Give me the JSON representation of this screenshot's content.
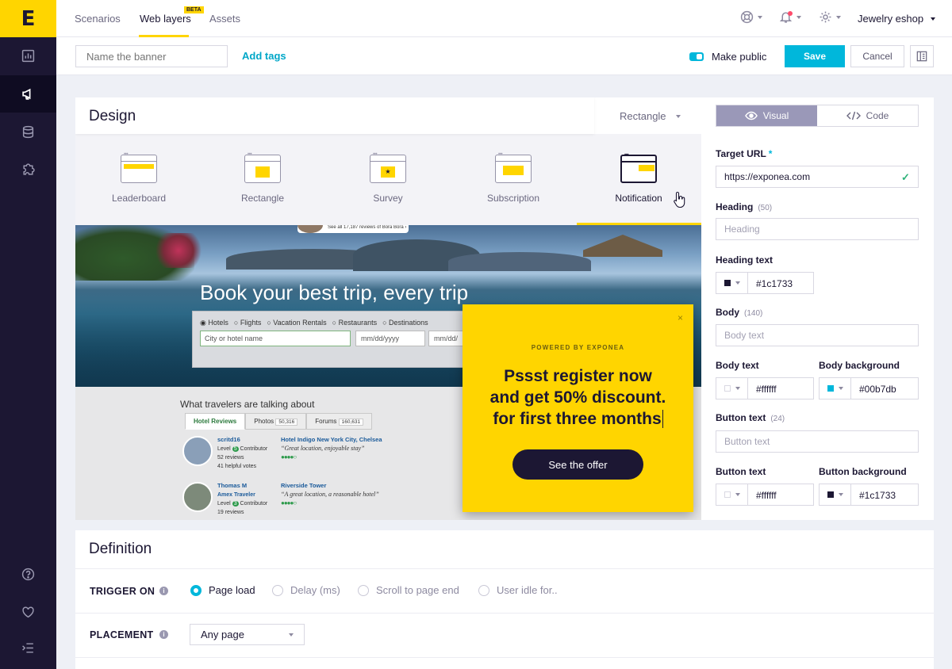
{
  "brand": {
    "logo_text": "E"
  },
  "sidebar": {
    "items": [
      {
        "icon": "chart-icon"
      },
      {
        "icon": "megaphone-icon",
        "active": true
      },
      {
        "icon": "database-icon"
      },
      {
        "icon": "puzzle-icon"
      }
    ],
    "bottom_items": [
      {
        "icon": "help-icon"
      },
      {
        "icon": "heart-icon"
      },
      {
        "icon": "collapse-menu-icon"
      }
    ]
  },
  "topnav": {
    "tabs": [
      {
        "label": "Scenarios"
      },
      {
        "label": "Web layers",
        "badge": "BETA",
        "active": true
      },
      {
        "label": "Assets"
      }
    ],
    "account_label": "Jewelry eshop"
  },
  "toolbar": {
    "name_placeholder": "Name the banner",
    "add_tags_label": "Add tags",
    "make_public_label": "Make public",
    "make_public_on": true,
    "save_label": "Save",
    "cancel_label": "Cancel"
  },
  "design": {
    "title": "Design",
    "shape_selected": "Rectangle",
    "templates": [
      {
        "label": "Leaderboard"
      },
      {
        "label": "Rectangle"
      },
      {
        "label": "Survey"
      },
      {
        "label": "Subscription"
      },
      {
        "label": "Notification",
        "active": true
      }
    ]
  },
  "preview": {
    "reviews_count_text": "See all 17,187 reviews of Bora Bora ›",
    "headline": "Book your best trip, every trip",
    "search_options": [
      "Hotels",
      "Flights",
      "Vacation Rentals",
      "Restaurants",
      "Destinations"
    ],
    "city_placeholder": "City or hotel name",
    "date_placeholder_1": "mm/dd/yyyy",
    "date_placeholder_2": "mm/dd/",
    "talk_title": "What travelers are talking about",
    "tabs": [
      {
        "label": "Hotel Reviews"
      },
      {
        "label": "Photos",
        "count": "50,316"
      },
      {
        "label": "Forums",
        "count": "160,631"
      }
    ],
    "reviews": [
      {
        "name": "scritd16",
        "level": "Level",
        "level_num": "5",
        "role": "Contributor",
        "reviews": "52 reviews",
        "votes": "41 helpful votes",
        "hotel": "Hotel Indigo New York City, Chelsea",
        "quote": "“Great location, enjoyable stay”"
      },
      {
        "name": "Thomas M",
        "name2": "Amex Traveler",
        "level": "Level",
        "level_num": "3",
        "role": "Contributor",
        "reviews": "19 reviews",
        "hotel": "Riverside Tower",
        "quote": "“A great location, a reasonable hotel”"
      }
    ]
  },
  "popup": {
    "close_glyph": "×",
    "powered_by": "POWERED BY EXPONEA",
    "heading_line1": "Pssst register now",
    "heading_line2": "and get 50% discount.",
    "heading_line3": "for first three months",
    "button_label": "See the offer",
    "background": "#ffd500"
  },
  "panel": {
    "tabs": [
      {
        "label": "Visual",
        "active": true
      },
      {
        "label": "Code"
      }
    ],
    "target_url_label": "Target URL",
    "target_url_required": "*",
    "target_url_value": "https://exponea.com",
    "heading_label": "Heading",
    "heading_count": "(50)",
    "heading_placeholder": "Heading",
    "heading_text_label": "Heading text",
    "heading_text_color": "#1c1733",
    "body_label": "Body",
    "body_count": "(140)",
    "body_placeholder": "Body text",
    "body_text_label": "Body text",
    "body_text_color": "#ffffff",
    "body_background_label": "Body background",
    "body_background_color": "#00b7db",
    "button_text_label": "Button text",
    "button_text_count": "(24)",
    "button_text_placeholder": "Button text",
    "button_text_color_label": "Button text",
    "button_text_color": "#ffffff",
    "button_background_label": "Button background",
    "button_background_color": "#1c1733"
  },
  "definition": {
    "title": "Definition",
    "trigger_label": "TRIGGER ON",
    "trigger_options": [
      {
        "label": "Page load",
        "selected": true
      },
      {
        "label": "Delay (ms)"
      },
      {
        "label": "Scroll to page end"
      },
      {
        "label": "User idle for.."
      }
    ],
    "placement_label": "PLACEMENT",
    "placement_value": "Any page"
  },
  "colors": {
    "accent": "#00b7db",
    "brand_yellow": "#ffd500",
    "dark": "#1c1733"
  }
}
